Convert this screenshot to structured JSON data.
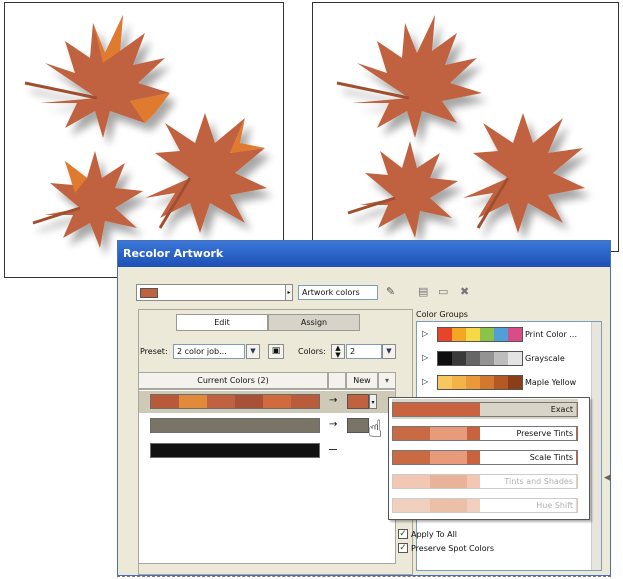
{
  "dialog": {
    "title": "Recolor Artwork",
    "artwork_colors_field": "Artwork colors",
    "color_groups_label": "Color Groups",
    "tabs": [
      {
        "label": "Edit"
      },
      {
        "label": "Assign"
      }
    ],
    "preset_label": "Preset:",
    "preset_value": "2 color job...",
    "colors_label": "Colors:",
    "colors_value": "2",
    "current_colors_header": "Current Colors (2)",
    "new_header": "New",
    "color_groups": [
      {
        "name": "Print Color ...",
        "colors": [
          "#e7442a",
          "#f5a623",
          "#f7d948",
          "#8bc34a",
          "#4f9fd8",
          "#d94c87"
        ]
      },
      {
        "name": "Grayscale",
        "colors": [
          "#0e0e0e",
          "#3a3a3a",
          "#666666",
          "#939393",
          "#bdbdbd",
          "#e3e3e3"
        ]
      },
      {
        "name": "Maple Yellow",
        "colors": [
          "#f6c85f",
          "#f3b347",
          "#e9983a",
          "#d4772f",
          "#b35a24",
          "#8a3e1a"
        ]
      }
    ],
    "current_rows": [
      {
        "colors": [
          "#b85a3a",
          "#e08a3a",
          "#c0623f",
          "#a85137",
          "#d06b3e",
          "#b95c3c"
        ],
        "new_color": "#c0623f"
      },
      {
        "colors": [
          "#7a7466"
        ],
        "new_color": "#7a7466"
      },
      {
        "colors": [
          "#111111"
        ],
        "new_color": ""
      }
    ],
    "menu_items": [
      {
        "label": "Exact",
        "colors": [
          "#c8623f",
          "#e0a080"
        ],
        "disabled": false,
        "selected": true
      },
      {
        "label": "Preserve Tints",
        "colors": [
          "#c86b45",
          "#e89b7a",
          "#c8623f",
          "#e0905f",
          "#c8623f"
        ],
        "disabled": false,
        "selected": false
      },
      {
        "label": "Scale Tints",
        "colors": [
          "#c86b45",
          "#e89b7a",
          "#c8623f",
          "#d08060",
          "#c8623f"
        ],
        "disabled": false,
        "selected": false
      },
      {
        "label": "Tints and Shades",
        "colors": [
          "#f2c7b4",
          "#e9b39a",
          "#f2c7b4",
          "#eab99f",
          "#f2c7b4"
        ],
        "disabled": true,
        "selected": false
      },
      {
        "label": "Hue Shift",
        "colors": [
          "#f2d0c0",
          "#ecbfa9",
          "#f2d0c0",
          "#eec3ae",
          "#f2d0c0"
        ],
        "disabled": true,
        "selected": false
      }
    ],
    "apply_to_all_label": "Apply To All",
    "preserve_spot_label": "Preserve Spot Colors",
    "arrow_glyph": "→"
  },
  "colors": {
    "leaf_main": "#c0623f",
    "leaf_orange": "#e07a2e",
    "dialog_bg": "#ece9d8",
    "titlebar": "#2a60c8"
  }
}
